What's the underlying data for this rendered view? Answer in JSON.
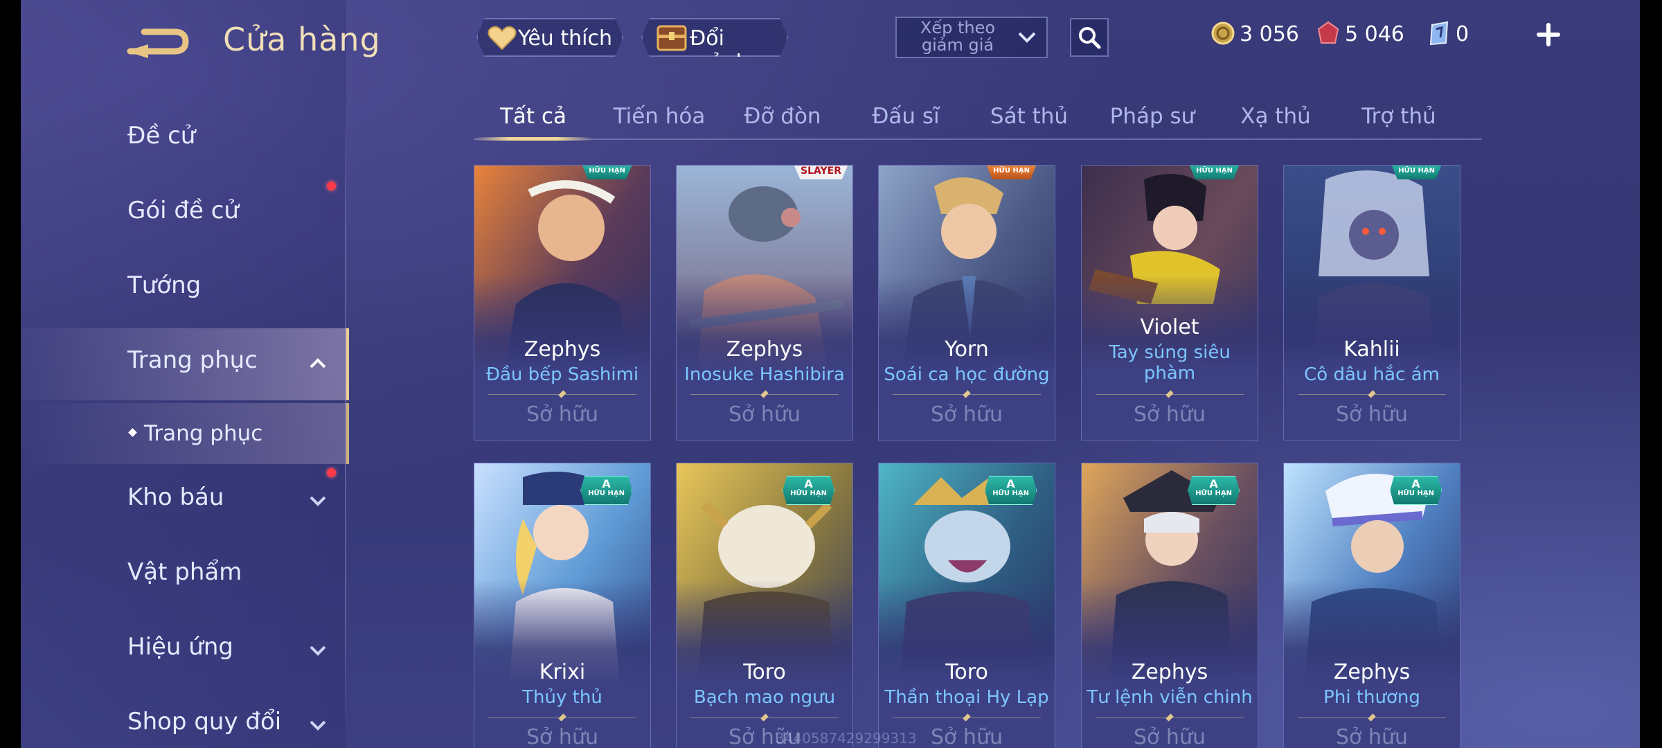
{
  "header": {
    "title": "Cửa hàng",
    "favorites_label": "Yêu thích",
    "exchange_label": "Đổi mảnh",
    "sort_label": "Xếp theo giảm giá",
    "currencies": [
      {
        "icon": "gold-coin-icon",
        "value": "3 056"
      },
      {
        "icon": "red-gem-icon",
        "value": "5 046"
      },
      {
        "icon": "ticket-icon",
        "value": "0"
      }
    ]
  },
  "sidebar": {
    "items": [
      {
        "label": "Đề cử",
        "dot": false,
        "chevron": ""
      },
      {
        "label": "Gói đề cử",
        "dot": true,
        "chevron": ""
      },
      {
        "label": "Tướng",
        "dot": false,
        "chevron": ""
      },
      {
        "label": "Trang phục",
        "dot": false,
        "chevron": "up"
      },
      {
        "label": "Trang phục",
        "dot": false,
        "chevron": ""
      },
      {
        "label": "Kho báu",
        "dot": true,
        "chevron": "down"
      },
      {
        "label": "Vật phẩm",
        "dot": false,
        "chevron": ""
      },
      {
        "label": "Hiệu ứng",
        "dot": false,
        "chevron": "down"
      },
      {
        "label": "Shop quy đổi",
        "dot": false,
        "chevron": "down"
      }
    ]
  },
  "tabs": [
    "Tất cả",
    "Tiến hóa",
    "Đỡ đòn",
    "Đấu sĩ",
    "Sát thủ",
    "Pháp sư",
    "Xạ thủ",
    "Trợ thủ"
  ],
  "active_tab": "Tất cả",
  "owned_label": "Sở hữu",
  "cards": [
    {
      "hero": "Zephys",
      "skin": "Đầu bếp Sashimi",
      "badge": "HỮU HẠN",
      "grade": "",
      "owned": "Sở hữu"
    },
    {
      "hero": "Zephys",
      "skin": "Inosuke Hashibira",
      "badge": "SLAYER",
      "grade": "",
      "owned": "Sở hữu"
    },
    {
      "hero": "Yorn",
      "skin": "Soái ca học đường",
      "badge": "HỮU HẠN",
      "grade": "",
      "owned": "Sở hữu"
    },
    {
      "hero": "Violet",
      "skin": "Tay súng siêu phàm",
      "badge": "HỮU HẠN",
      "grade": "",
      "owned": "Sở hữu"
    },
    {
      "hero": "Kahlii",
      "skin": "Cô dâu hắc ám",
      "badge": "HỮU HẠN",
      "grade": "",
      "owned": "Sở hữu"
    },
    {
      "hero": "Krixi",
      "skin": "Thủy thủ",
      "badge": "HỮU HẠN",
      "grade": "A",
      "owned": "Sở hữu"
    },
    {
      "hero": "Toro",
      "skin": "Bạch mao ngưu",
      "badge": "HỮU HẠN",
      "grade": "A",
      "owned": "Sở hữu"
    },
    {
      "hero": "Toro",
      "skin": "Thần thoại Hy Lạp",
      "badge": "HỮU HẠN",
      "grade": "A",
      "owned": "Sở hữu"
    },
    {
      "hero": "Zephys",
      "skin": "Tư lệnh viễn chinh",
      "badge": "HỮU HẠN",
      "grade": "A",
      "owned": "Sở hữu"
    },
    {
      "hero": "Zephys",
      "skin": "Phi thương",
      "badge": "HỮU HẠN",
      "grade": "A",
      "owned": "Sở hữu"
    }
  ],
  "watermark": "3440587429299313",
  "colors": {
    "accent_gold": "#f2d99a",
    "skin_name": "#7cc6ff",
    "notify_dot": "#ff3b4a"
  }
}
